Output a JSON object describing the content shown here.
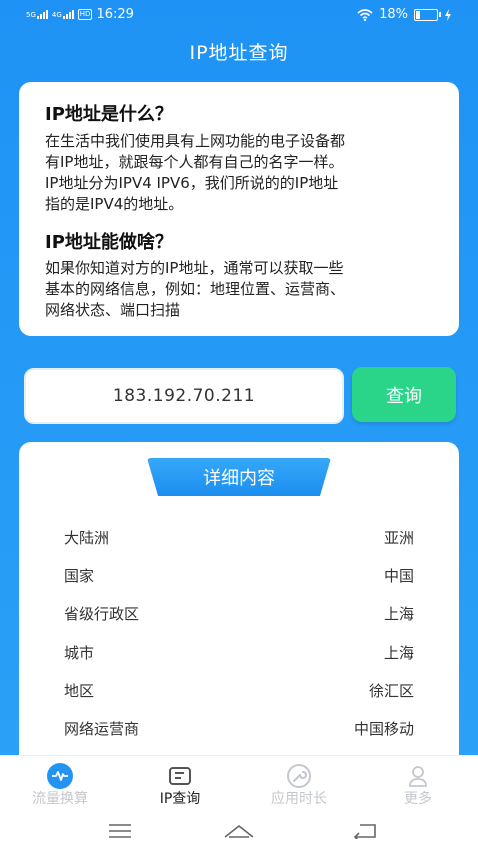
{
  "status_bar": {
    "network1": "5G",
    "network2": "4G",
    "hd": "HD",
    "time": "16:29",
    "battery_percent": "18%",
    "battery_level": 0.18
  },
  "header": {
    "title": "IP地址查询"
  },
  "intro": {
    "q1_title": "IP地址是什么？",
    "q1_lines": [
      "在生活中我们使用具有上网功能的电子设备都",
      "有IP地址，就跟每个人都有自己的名字一样。",
      "IP地址分为IPV4 IPV6，我们所说的的IP地址",
      "指的是IPV4的地址。"
    ],
    "q2_title": "IP地址能做啥？",
    "q2_lines": [
      "如果你知道对方的IP地址，通常可以获取一些",
      "基本的网络信息，例如：地理位置、运营商、",
      "网络状态、端口扫描"
    ]
  },
  "search": {
    "ip_value": "183.192.70.211",
    "button_label": "查询"
  },
  "details": {
    "title": "详细内容",
    "rows": [
      {
        "key": "大陆洲",
        "value": "亚洲"
      },
      {
        "key": "国家",
        "value": "中国"
      },
      {
        "key": "省级行政区",
        "value": "上海"
      },
      {
        "key": "城市",
        "value": "上海"
      },
      {
        "key": "地区",
        "value": "徐汇区"
      },
      {
        "key": "网络运营商",
        "value": "中国移动"
      }
    ]
  },
  "tabs": [
    {
      "label": "流量换算",
      "icon": "pulse-icon",
      "active": false
    },
    {
      "label": "IP查询",
      "icon": "document-icon",
      "active": true
    },
    {
      "label": "应用时长",
      "icon": "wrench-icon",
      "active": false
    },
    {
      "label": "更多",
      "icon": "user-icon",
      "active": false
    }
  ],
  "colors": {
    "primary": "#2494f3",
    "accent": "#2ad58a",
    "inactive": "#c4c7cc"
  }
}
